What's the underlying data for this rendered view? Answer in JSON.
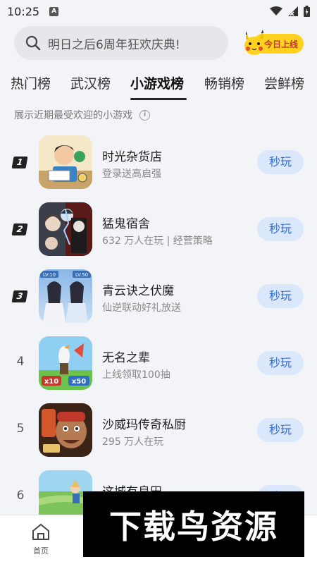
{
  "status_bar": {
    "time": "10:25",
    "a_label": "A"
  },
  "search": {
    "placeholder": "明日之后6周年狂欢庆典!"
  },
  "promo": {
    "label": "今日上线"
  },
  "tabs": [
    {
      "label": "热门榜",
      "active": false
    },
    {
      "label": "武汉榜",
      "active": false
    },
    {
      "label": "小游戏榜",
      "active": true
    },
    {
      "label": "畅销榜",
      "active": false
    },
    {
      "label": "尝鲜榜",
      "active": false
    }
  ],
  "hint": {
    "text": "展示近期最受欢迎的小游戏",
    "icon": "info-icon"
  },
  "games": [
    {
      "rank": "1",
      "name": "时光杂货店",
      "sub": "登录送高启强",
      "button": "秒玩"
    },
    {
      "rank": "2",
      "name": "猛鬼宿舍",
      "sub": "632 万人在玩 | 经营策略",
      "button": "秒玩"
    },
    {
      "rank": "3",
      "name": "青云诀之伏魔",
      "sub": "仙逆联动好礼放送",
      "button": "秒玩"
    },
    {
      "rank": "4",
      "name": "无名之辈",
      "sub": "上线领取100抽",
      "button": "秒玩"
    },
    {
      "rank": "5",
      "name": "沙威玛传奇私厨",
      "sub": "295 万人在玩",
      "button": "秒玩"
    },
    {
      "rank": "6",
      "name": "这城有良田",
      "sub": "",
      "button": "秒玩"
    }
  ],
  "icon_labels": {
    "lv_left": "LV.10",
    "lv_right": "LV.50",
    "x10": "x10",
    "x50": "x50"
  },
  "bottom_nav": {
    "home_label": "首页"
  },
  "watermark": {
    "text": "下载鸟资源"
  }
}
